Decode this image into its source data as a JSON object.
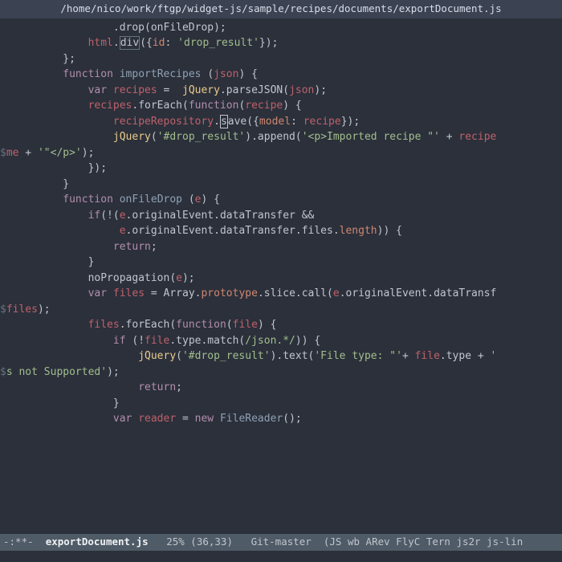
{
  "titlebar": "/home/nico/work/ftgp/widget-js/sample/recipes/documents/exportDocument.js",
  "code": {
    "lines": [
      [
        [
          "d",
          "                  .drop(onFileDrop);"
        ]
      ],
      [
        [
          "d",
          ""
        ]
      ],
      [
        [
          "d",
          "              "
        ],
        [
          "id",
          "html"
        ],
        [
          "d",
          "."
        ],
        [
          "hl",
          "div"
        ],
        [
          "d",
          "({"
        ],
        [
          "pr",
          "id"
        ],
        [
          "d",
          ": "
        ],
        [
          "st",
          "'drop_result'"
        ],
        [
          "d",
          "});"
        ]
      ],
      [
        [
          "d",
          "          };"
        ]
      ],
      [
        [
          "d",
          ""
        ]
      ],
      [
        [
          "d",
          "          "
        ],
        [
          "kw",
          "function "
        ],
        [
          "fn",
          "importRecipes "
        ],
        [
          "d",
          "("
        ],
        [
          "id",
          "json"
        ],
        [
          "d",
          ") {"
        ]
      ],
      [
        [
          "d",
          "              "
        ],
        [
          "kw",
          "var "
        ],
        [
          "id",
          "recipes"
        ],
        [
          "d",
          " =  "
        ],
        [
          "jq",
          "jQuery"
        ],
        [
          "d",
          ".parseJSON("
        ],
        [
          "id",
          "json"
        ],
        [
          "d",
          ");"
        ]
      ],
      [
        [
          "d",
          ""
        ]
      ],
      [
        [
          "d",
          "              "
        ],
        [
          "id",
          "recipes"
        ],
        [
          "d",
          ".forEach("
        ],
        [
          "kw",
          "function"
        ],
        [
          "d",
          "("
        ],
        [
          "id",
          "recipe"
        ],
        [
          "d",
          ") {"
        ]
      ],
      [
        [
          "d",
          "                  "
        ],
        [
          "id",
          "recipeRepository"
        ],
        [
          "d",
          "."
        ],
        [
          "cur",
          "s"
        ],
        [
          "d",
          "ave({"
        ],
        [
          "pr",
          "model"
        ],
        [
          "d",
          ": "
        ],
        [
          "id",
          "recipe"
        ],
        [
          "d",
          "});"
        ]
      ],
      [
        [
          "d",
          "                  "
        ],
        [
          "jq",
          "jQuery"
        ],
        [
          "d",
          "("
        ],
        [
          "st",
          "'#drop_result'"
        ],
        [
          "d",
          ").append("
        ],
        [
          "st",
          "'<p>Imported recipe \"'"
        ],
        [
          "d",
          " + "
        ],
        [
          "id",
          "recipe"
        ]
      ],
      [
        [
          "wrap",
          "$"
        ],
        [
          "id",
          "me"
        ],
        [
          "d",
          " + "
        ],
        [
          "st",
          "'\"</p>'"
        ],
        [
          "d",
          ");"
        ]
      ],
      [
        [
          "d",
          "              });"
        ]
      ],
      [
        [
          "d",
          "          }"
        ]
      ],
      [
        [
          "d",
          ""
        ]
      ],
      [
        [
          "d",
          "          "
        ],
        [
          "kw",
          "function "
        ],
        [
          "fn",
          "onFileDrop "
        ],
        [
          "d",
          "("
        ],
        [
          "id",
          "e"
        ],
        [
          "d",
          ") {"
        ]
      ],
      [
        [
          "d",
          "              "
        ],
        [
          "kw",
          "if"
        ],
        [
          "d",
          "(!("
        ],
        [
          "id",
          "e"
        ],
        [
          "d",
          ".originalEvent.dataTransfer &&"
        ]
      ],
      [
        [
          "d",
          "                   "
        ],
        [
          "id",
          "e"
        ],
        [
          "d",
          ".originalEvent.dataTransfer.files."
        ],
        [
          "pr",
          "length"
        ],
        [
          "d",
          ")) {"
        ]
      ],
      [
        [
          "d",
          "                  "
        ],
        [
          "kw",
          "return"
        ],
        [
          "d",
          ";"
        ]
      ],
      [
        [
          "d",
          "              }"
        ]
      ],
      [
        [
          "d",
          ""
        ]
      ],
      [
        [
          "d",
          "              noPropagation("
        ],
        [
          "id",
          "e"
        ],
        [
          "d",
          ");"
        ]
      ],
      [
        [
          "d",
          ""
        ]
      ],
      [
        [
          "d",
          "              "
        ],
        [
          "kw",
          "var "
        ],
        [
          "id",
          "files"
        ],
        [
          "d",
          " = Array."
        ],
        [
          "pr",
          "prototype"
        ],
        [
          "d",
          ".slice.call("
        ],
        [
          "id",
          "e"
        ],
        [
          "d",
          ".originalEvent.dataTransf"
        ]
      ],
      [
        [
          "wrap",
          "$"
        ],
        [
          "id",
          "files"
        ],
        [
          "d",
          ");"
        ]
      ],
      [
        [
          "d",
          "              "
        ],
        [
          "id",
          "files"
        ],
        [
          "d",
          ".forEach("
        ],
        [
          "kw",
          "function"
        ],
        [
          "d",
          "("
        ],
        [
          "id",
          "file"
        ],
        [
          "d",
          ") {"
        ]
      ],
      [
        [
          "d",
          "                  "
        ],
        [
          "kw",
          "if "
        ],
        [
          "d",
          "(!"
        ],
        [
          "id",
          "file"
        ],
        [
          "d",
          ".type.match("
        ],
        [
          "st",
          "/json.*/"
        ],
        [
          "d",
          ")) {"
        ]
      ],
      [
        [
          "d",
          "                      "
        ],
        [
          "jq",
          "jQuery"
        ],
        [
          "d",
          "("
        ],
        [
          "st",
          "'#drop_result'"
        ],
        [
          "d",
          ").text("
        ],
        [
          "st",
          "'File type: \"'"
        ],
        [
          "d",
          "+ "
        ],
        [
          "id",
          "file"
        ],
        [
          "d",
          ".type + "
        ],
        [
          "st",
          "'"
        ]
      ],
      [
        [
          "wrap",
          "$"
        ],
        [
          "st",
          "s not Supported'"
        ],
        [
          "d",
          ");"
        ]
      ],
      [
        [
          "d",
          "                      "
        ],
        [
          "kw",
          "return"
        ],
        [
          "d",
          ";"
        ]
      ],
      [
        [
          "d",
          "                  }"
        ]
      ],
      [
        [
          "d",
          ""
        ]
      ],
      [
        [
          "d",
          "                  "
        ],
        [
          "kw",
          "var "
        ],
        [
          "id",
          "reader"
        ],
        [
          "d",
          " = "
        ],
        [
          "kw",
          "new "
        ],
        [
          "fn",
          "FileReader"
        ],
        [
          "d",
          "();"
        ]
      ]
    ]
  },
  "modeline": {
    "left": "-:**-  ",
    "buffer": "exportDocument.js",
    "position": "   25% (36,33)   ",
    "vc": "Git-master",
    "modes": "  (JS wb ARev FlyC Tern js2r js-lin"
  }
}
